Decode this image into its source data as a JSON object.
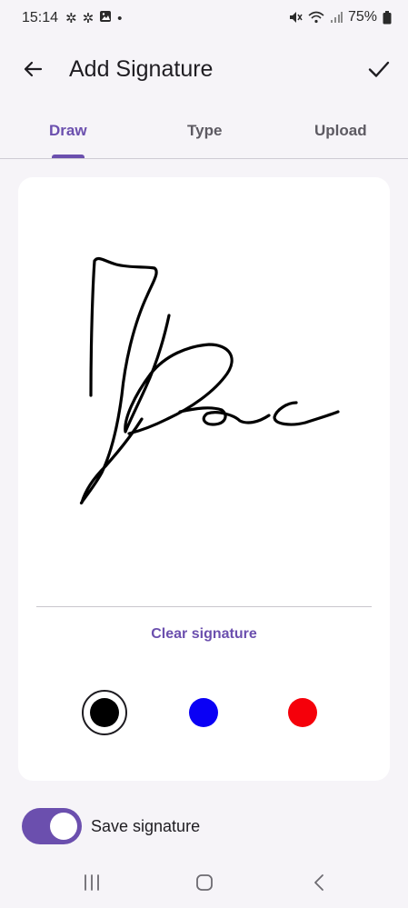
{
  "status_bar": {
    "time": "15:14",
    "battery": "75%"
  },
  "app_bar": {
    "title": "Add Signature"
  },
  "tabs": [
    {
      "label": "Draw",
      "active": true
    },
    {
      "label": "Type",
      "active": false
    },
    {
      "label": "Upload",
      "active": false
    }
  ],
  "signature": {
    "clear_label": "Clear signature",
    "colors": [
      {
        "name": "black",
        "hex": "#000000",
        "selected": true
      },
      {
        "name": "blue",
        "hex": "#0a00f5",
        "selected": false
      },
      {
        "name": "red",
        "hex": "#f5000a",
        "selected": false
      }
    ]
  },
  "save_toggle": {
    "label": "Save signature",
    "on": true
  },
  "theme": {
    "accent": "#6b4fae"
  }
}
